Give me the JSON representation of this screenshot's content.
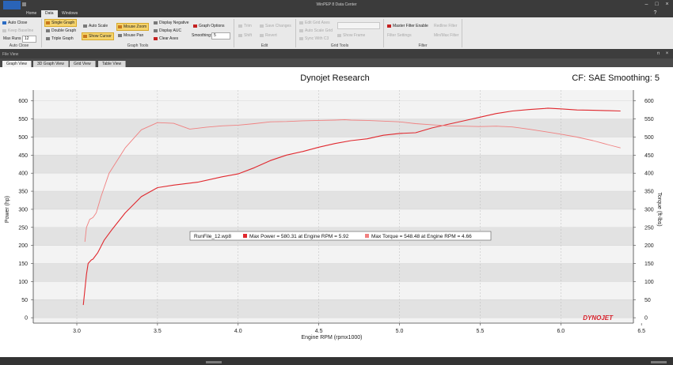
{
  "window": {
    "title": "WinPEP 8 Data Center"
  },
  "menu": {
    "tabs": [
      "Home",
      "Data",
      "Windows"
    ],
    "active": "Data"
  },
  "ribbon": {
    "auto_close": {
      "auto_close_label": "Auto Close",
      "keep_baseline_label": "Keep Baseline",
      "max_runs_label": "Max Runs",
      "max_runs_value": "12",
      "group_label": "Auto Close"
    },
    "graph_tools": {
      "single_graph": "Single Graph",
      "double_graph": "Double Graph",
      "triple_graph": "Triple Graph",
      "auto_scale": "Auto Scale",
      "show_cursor": "Show Cursor",
      "mouse_zoom": "Mouse Zoom",
      "mouse_pan": "Mouse Pan",
      "display_negative": "Display Negative",
      "display_auc": "Display AUC",
      "clear_axes": "Clear Axes",
      "graph_options": "Graph Options",
      "smoothing_label": "Smoothing:",
      "smoothing_value": "5",
      "group_label": "Graph Tools"
    },
    "edit": {
      "trim": "Trim",
      "shift": "Shift",
      "save_changes": "Save Changes",
      "revert": "Revert",
      "group_label": "Edit"
    },
    "grid_tools": {
      "edit_grid_axes": "Edit Grid Axes",
      "auto_scale_grid": "Auto Scale Grid",
      "sync_with_c3": "Sync With C3",
      "show_frame": "Show Frame",
      "group_label": "Grid Tools"
    },
    "filter": {
      "master_filter_enable": "Master Filter Enable",
      "redline_filter": "Redline Filter",
      "filter_settings": "Filter Settings",
      "minmax_filter": "Min/Max Filter",
      "group_label": "Filter"
    }
  },
  "panel": {
    "title": "File View"
  },
  "view_tabs": [
    "Graph View",
    "3D Graph View",
    "Grid View",
    "Table View"
  ],
  "view_tabs_active": "Graph View",
  "colors": {
    "power": "#e0282e",
    "torque": "#f08080",
    "accent": "#f5d36b"
  },
  "chart_data": {
    "type": "line",
    "title": "Dynojet Research",
    "header_right": "CF: SAE Smoothing: 5",
    "xlabel": "Engine RPM (rpmx1000)",
    "ylabel": "Power (hp)",
    "y2label": "Torque (ft-lbs)",
    "xlim": [
      2.73,
      6.45
    ],
    "ylim": [
      -15,
      630
    ],
    "y2lim": [
      -15,
      630
    ],
    "x_ticks": [
      3.0,
      3.5,
      4.0,
      4.5,
      5.0,
      5.5,
      6.0,
      6.5
    ],
    "x_tick_labels": [
      "3.0",
      "3.5",
      "4.0",
      "4.5",
      "5.0",
      "5.5",
      "6.0",
      "6.5"
    ],
    "y_ticks": [
      0,
      50,
      100,
      150,
      200,
      250,
      300,
      350,
      400,
      450,
      500,
      550,
      600
    ],
    "y2_ticks": [
      0,
      50,
      100,
      150,
      200,
      250,
      300,
      350,
      400,
      450,
      500,
      550,
      600
    ],
    "grid": true,
    "watermark": "DYNOJET",
    "legend": {
      "placement": "center",
      "file": "RunFile_12.wp8",
      "entries": [
        "Max Power = 580.31 at Engine RPM = 5.92",
        "Max Torque = 548.48 at Engine RPM = 4.66"
      ]
    },
    "series": [
      {
        "name": "Max Power",
        "axis": "left",
        "x": [
          3.04,
          3.06,
          3.07,
          3.09,
          3.1,
          3.13,
          3.17,
          3.22,
          3.3,
          3.4,
          3.5,
          3.6,
          3.75,
          3.9,
          4.0,
          4.1,
          4.2,
          4.3,
          4.4,
          4.5,
          4.6,
          4.7,
          4.8,
          4.9,
          5.0,
          5.1,
          5.2,
          5.3,
          5.4,
          5.5,
          5.6,
          5.7,
          5.8,
          5.9,
          5.92,
          6.0,
          6.1,
          6.2,
          6.3,
          6.37
        ],
        "y": [
          35,
          120,
          150,
          160,
          162,
          180,
          215,
          245,
          290,
          335,
          360,
          367,
          375,
          390,
          398,
          415,
          435,
          450,
          460,
          472,
          482,
          490,
          495,
          505,
          510,
          512,
          525,
          535,
          545,
          555,
          565,
          572,
          576,
          579,
          580,
          578,
          575,
          574,
          573,
          572
        ]
      },
      {
        "name": "Max Torque",
        "axis": "right",
        "x": [
          3.05,
          3.06,
          3.08,
          3.1,
          3.12,
          3.15,
          3.2,
          3.3,
          3.4,
          3.5,
          3.6,
          3.7,
          3.8,
          3.9,
          4.0,
          4.1,
          4.2,
          4.3,
          4.4,
          4.5,
          4.6,
          4.66,
          4.7,
          4.8,
          4.9,
          5.0,
          5.1,
          5.2,
          5.3,
          5.4,
          5.5,
          5.6,
          5.7,
          5.8,
          5.9,
          6.0,
          6.1,
          6.2,
          6.3,
          6.37
        ],
        "y": [
          210,
          250,
          272,
          277,
          290,
          335,
          400,
          470,
          520,
          540,
          538,
          522,
          527,
          531,
          533,
          537,
          542,
          543,
          545,
          546,
          547,
          548,
          547,
          546,
          544,
          542,
          537,
          534,
          531,
          530,
          529,
          530,
          528,
          522,
          515,
          508,
          500,
          490,
          478,
          470
        ]
      }
    ]
  }
}
